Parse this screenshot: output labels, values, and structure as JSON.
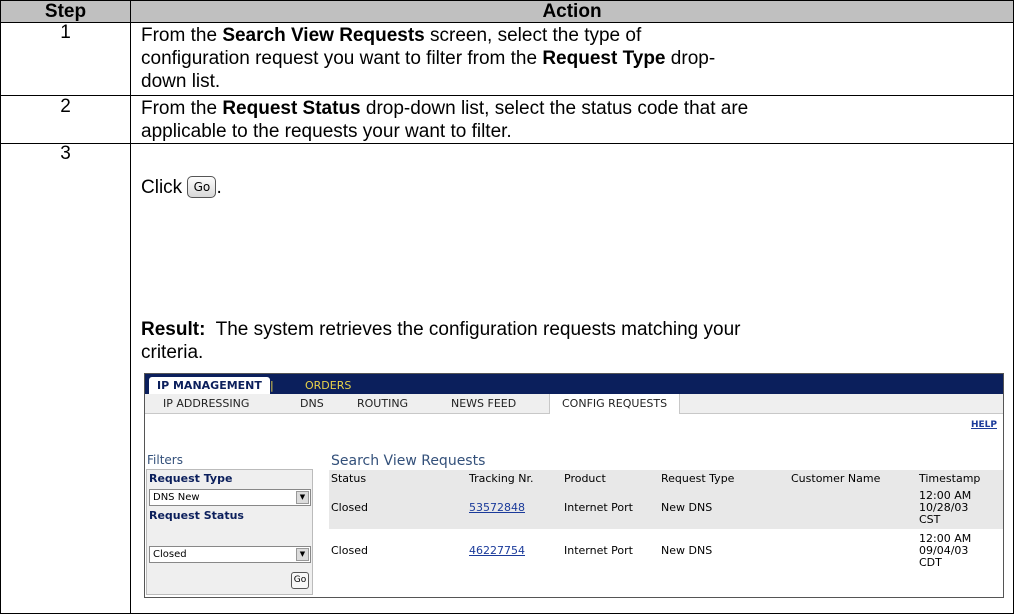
{
  "header": {
    "step": "Step",
    "action": "Action"
  },
  "steps": [
    {
      "num": "1",
      "line1_pre": "From the ",
      "line1_b1": "Search View Requests",
      "line1_post": " screen, select the type of",
      "line2_pre": "configuration request you want to filter from the ",
      "line2_b": "Request Type",
      "line2_post": " drop-",
      "line3": "down list."
    },
    {
      "num": "2",
      "line1_pre": "From the ",
      "line1_b": "Request Status",
      "line1_post": " drop-down list, select the status code that are",
      "line2": "applicable to the requests your want to filter."
    },
    {
      "num": "3",
      "click": "Click",
      "go_button": "Go",
      "click_end": ".",
      "result_label": "Result:",
      "result_text": "  The system retrieves the configuration requests matching your",
      "result_text2": "criteria."
    }
  ],
  "screenshot": {
    "top_tab": "IP MANAGEMENT",
    "separator": "|",
    "orders_tab": "ORDERS",
    "subtabs": [
      "IP ADDRESSING",
      "DNS",
      "ROUTING",
      "NEWS FEED",
      "CONFIG REQUESTS"
    ],
    "help": "HELP",
    "filters": {
      "title": "Filters",
      "request_type_label": "Request Type",
      "request_type_value": "DNS New",
      "request_status_label": "Request Status",
      "request_status_value": "Closed",
      "go": "Go"
    },
    "results": {
      "title": "Search View Requests",
      "columns": [
        "Status",
        "Tracking Nr.",
        "Product",
        "Request Type",
        "Customer Name",
        "Timestamp"
      ],
      "rows": [
        {
          "status": "Closed",
          "tracking": "53572848",
          "product": "Internet Port",
          "request_type": "New DNS",
          "customer": "",
          "timestamp": "12:00 AM 10/28/03 CST"
        },
        {
          "status": "Closed",
          "tracking": "46227754",
          "product": "Internet Port",
          "request_type": "New DNS",
          "customer": "",
          "timestamp": "12:00 AM 09/04/03 CDT"
        }
      ]
    },
    "colors": {
      "nav": "#0b1f5c",
      "nav_text": "#e8d24a",
      "link": "#1a3a9a",
      "header_bg": "#c0c0c0"
    }
  }
}
